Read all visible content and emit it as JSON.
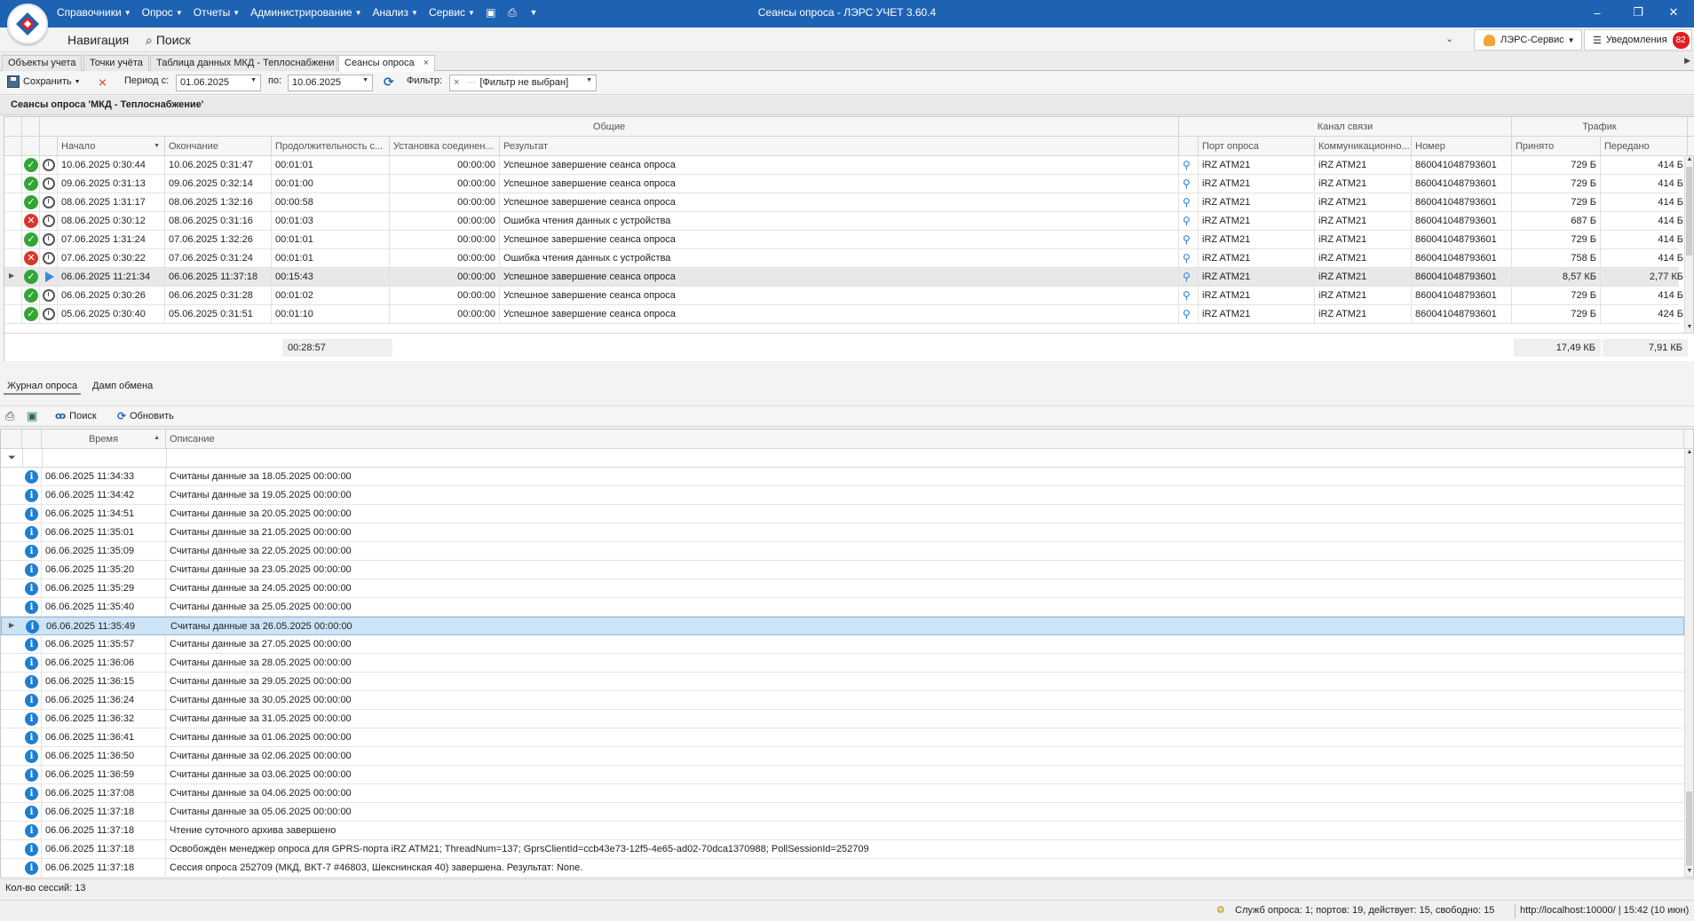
{
  "window": {
    "title": "Сеансы опроса - ЛЭРС УЧЕТ 3.60.4"
  },
  "menu": [
    {
      "label": "Справочники"
    },
    {
      "label": "Опрос"
    },
    {
      "label": "Отчеты"
    },
    {
      "label": "Администрирование"
    },
    {
      "label": "Анализ"
    },
    {
      "label": "Сервис"
    }
  ],
  "nav": {
    "navigation": "Навигация",
    "search": "Поиск",
    "user": "ЛЭРС-Сервис",
    "notifications": "Уведомления",
    "notif_count": "82"
  },
  "tabs": [
    {
      "label": "Объекты учета"
    },
    {
      "label": "Точки учёта"
    },
    {
      "label": "Таблица данных МКД - Теплоснабжени"
    },
    {
      "label": "Сеансы опроса",
      "close": "×"
    }
  ],
  "toolbar": {
    "save": "Сохранить",
    "period_from_label": "Период с:",
    "period_from": "01.06.2025",
    "period_to_label": "по:",
    "period_to": "10.06.2025",
    "filter_label": "Фильтр:",
    "filter_clear": "×",
    "filter_value": "[Фильтр не выбран]"
  },
  "section_title": "Сеансы опроса 'МКД - Теплоснабжение'",
  "sessions": {
    "groups": {
      "common": "Общие",
      "channel": "Канал связи",
      "traffic": "Трафик"
    },
    "columns": {
      "start": "Начало",
      "end": "Окончание",
      "duration": "Продолжительность с...",
      "connect": "Установка соединен...",
      "result": "Результат",
      "port": "Порт опроса",
      "comm": "Коммуникационно...",
      "number": "Номер",
      "received": "Принято",
      "sent": "Передано"
    },
    "rows": [
      {
        "status": "ok",
        "type": "clock",
        "start": "10.06.2025 0:30:44",
        "end": "10.06.2025 0:31:47",
        "duration": "00:01:01",
        "connect": "00:00:00",
        "result": "Успешное завершение сеанса опроса",
        "port": "iRZ ATM21",
        "comm": "iRZ ATM21",
        "number": "860041048793601",
        "received": "729 Б",
        "sent": "414 Б"
      },
      {
        "status": "ok",
        "type": "clock",
        "start": "09.06.2025 0:31:13",
        "end": "09.06.2025 0:32:14",
        "duration": "00:01:00",
        "connect": "00:00:00",
        "result": "Успешное завершение сеанса опроса",
        "port": "iRZ ATM21",
        "comm": "iRZ ATM21",
        "number": "860041048793601",
        "received": "729 Б",
        "sent": "414 Б"
      },
      {
        "status": "ok",
        "type": "clock",
        "start": "08.06.2025 1:31:17",
        "end": "08.06.2025 1:32:16",
        "duration": "00:00:58",
        "connect": "00:00:00",
        "result": "Успешное завершение сеанса опроса",
        "port": "iRZ ATM21",
        "comm": "iRZ ATM21",
        "number": "860041048793601",
        "received": "729 Б",
        "sent": "414 Б"
      },
      {
        "status": "err",
        "type": "clock",
        "start": "08.06.2025 0:30:12",
        "end": "08.06.2025 0:31:16",
        "duration": "00:01:03",
        "connect": "00:00:00",
        "result": "Ошибка чтения данных с устройства",
        "port": "iRZ ATM21",
        "comm": "iRZ ATM21",
        "number": "860041048793601",
        "received": "687 Б",
        "sent": "414 Б"
      },
      {
        "status": "ok",
        "type": "clock",
        "start": "07.06.2025 1:31:24",
        "end": "07.06.2025 1:32:26",
        "duration": "00:01:01",
        "connect": "00:00:00",
        "result": "Успешное завершение сеанса опроса",
        "port": "iRZ ATM21",
        "comm": "iRZ ATM21",
        "number": "860041048793601",
        "received": "729 Б",
        "sent": "414 Б"
      },
      {
        "status": "err",
        "type": "clock",
        "start": "07.06.2025 0:30:22",
        "end": "07.06.2025 0:31:24",
        "duration": "00:01:01",
        "connect": "00:00:00",
        "result": "Ошибка чтения данных с устройства",
        "port": "iRZ ATM21",
        "comm": "iRZ ATM21",
        "number": "860041048793601",
        "received": "758 Б",
        "sent": "414 Б"
      },
      {
        "status": "ok",
        "type": "play",
        "selected": true,
        "start": "06.06.2025 11:21:34",
        "end": "06.06.2025 11:37:18",
        "duration": "00:15:43",
        "connect": "00:00:00",
        "result": "Успешное завершение сеанса опроса",
        "port": "iRZ ATM21",
        "comm": "iRZ ATM21",
        "number": "860041048793601",
        "received": "8,57 КБ",
        "sent": "2,77 КБ"
      },
      {
        "status": "ok",
        "type": "clock",
        "start": "06.06.2025 0:30:26",
        "end": "06.06.2025 0:31:28",
        "duration": "00:01:02",
        "connect": "00:00:00",
        "result": "Успешное завершение сеанса опроса",
        "port": "iRZ ATM21",
        "comm": "iRZ ATM21",
        "number": "860041048793601",
        "received": "729 Б",
        "sent": "414 Б"
      },
      {
        "status": "ok",
        "type": "clock",
        "start": "05.06.2025 0:30:40",
        "end": "05.06.2025 0:31:51",
        "duration": "00:01:10",
        "connect": "00:00:00",
        "result": "Успешное завершение сеанса опроса",
        "port": "iRZ ATM21",
        "comm": "iRZ ATM21",
        "number": "860041048793601",
        "received": "729 Б",
        "sent": "424 Б"
      }
    ],
    "totals": {
      "duration": "00:28:57",
      "received": "17,49 КБ",
      "sent": "7,91 КБ"
    }
  },
  "bottom_tabs": [
    {
      "label": "Журнал опроса"
    },
    {
      "label": "Дамп обмена"
    }
  ],
  "log_toolbar": {
    "search": "Поиск",
    "refresh": "Обновить"
  },
  "log": {
    "columns": {
      "time": "Время",
      "description": "Описание"
    },
    "rows": [
      {
        "time": "06.06.2025 11:34:33",
        "text": "Считаны данные за 18.05.2025 00:00:00"
      },
      {
        "time": "06.06.2025 11:34:42",
        "text": "Считаны данные за 19.05.2025 00:00:00"
      },
      {
        "time": "06.06.2025 11:34:51",
        "text": "Считаны данные за 20.05.2025 00:00:00"
      },
      {
        "time": "06.06.2025 11:35:01",
        "text": "Считаны данные за 21.05.2025 00:00:00"
      },
      {
        "time": "06.06.2025 11:35:09",
        "text": "Считаны данные за 22.05.2025 00:00:00"
      },
      {
        "time": "06.06.2025 11:35:20",
        "text": "Считаны данные за 23.05.2025 00:00:00"
      },
      {
        "time": "06.06.2025 11:35:29",
        "text": "Считаны данные за 24.05.2025 00:00:00"
      },
      {
        "time": "06.06.2025 11:35:40",
        "text": "Считаны данные за 25.05.2025 00:00:00"
      },
      {
        "time": "06.06.2025 11:35:49",
        "text": "Считаны данные за 26.05.2025 00:00:00",
        "selected": true
      },
      {
        "time": "06.06.2025 11:35:57",
        "text": "Считаны данные за 27.05.2025 00:00:00"
      },
      {
        "time": "06.06.2025 11:36:06",
        "text": "Считаны данные за 28.05.2025 00:00:00"
      },
      {
        "time": "06.06.2025 11:36:15",
        "text": "Считаны данные за 29.05.2025 00:00:00"
      },
      {
        "time": "06.06.2025 11:36:24",
        "text": "Считаны данные за 30.05.2025 00:00:00"
      },
      {
        "time": "06.06.2025 11:36:32",
        "text": "Считаны данные за 31.05.2025 00:00:00"
      },
      {
        "time": "06.06.2025 11:36:41",
        "text": "Считаны данные за 01.06.2025 00:00:00"
      },
      {
        "time": "06.06.2025 11:36:50",
        "text": "Считаны данные за 02.06.2025 00:00:00"
      },
      {
        "time": "06.06.2025 11:36:59",
        "text": "Считаны данные за 03.06.2025 00:00:00"
      },
      {
        "time": "06.06.2025 11:37:08",
        "text": "Считаны данные за 04.06.2025 00:00:00"
      },
      {
        "time": "06.06.2025 11:37:18",
        "text": "Считаны данные за 05.06.2025 00:00:00"
      },
      {
        "time": "06.06.2025 11:37:18",
        "text": "Чтение суточного архива завершено"
      },
      {
        "time": "06.06.2025 11:37:18",
        "text": "Освобождён менеджер опроса для GPRS-порта iRZ ATM21; ThreadNum=137; GprsClientId=ccb43e73-12f5-4e65-ad02-70dca1370988; PollSessionId=252709"
      },
      {
        "time": "06.06.2025 11:37:18",
        "text": "Сессия опроса 252709 (МКД, ВКТ-7 #46803, Шекснинская 40) завершена. Результат: None."
      }
    ]
  },
  "status": {
    "sessions_count": "Кол-во сессий: 13",
    "services": "Служб опроса: 1; портов: 19, действует: 15, свободно: 15",
    "server": "http://localhost:10000/ | 15:42 (10 июн)"
  },
  "colors": {
    "titlebar": "#1e63b3",
    "ok": "#33a535",
    "error": "#d9362b",
    "info": "#1e7fd0",
    "selection": "#cde4f7"
  }
}
